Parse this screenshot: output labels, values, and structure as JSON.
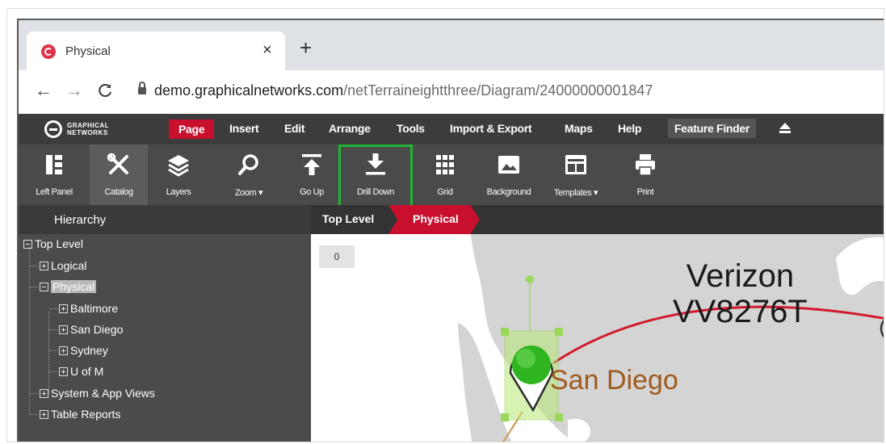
{
  "browser": {
    "tab_title": "Physical",
    "tab_close": "×",
    "new_tab": "+",
    "back": "←",
    "forward": "→",
    "reload": "C",
    "url_host": "demo.graphicalnetworks.com",
    "url_path": "/netTerraineightthree/Diagram/24000000001847"
  },
  "app": {
    "logo_line1": "GRAPHICAL",
    "logo_line2": "NETWORKS",
    "menu": [
      "Page",
      "Insert",
      "Edit",
      "Arrange",
      "Tools",
      "Import & Export",
      "Maps",
      "Help"
    ],
    "feature_finder": "Feature Finder",
    "colors": {
      "accent": "#c8102e",
      "highlight": "#21b534",
      "header": "#3c3c3c"
    }
  },
  "toolbar": {
    "tools": [
      {
        "label": "Left Panel",
        "icon": "left-panel-icon"
      },
      {
        "label": "Catalog",
        "icon": "catalog-tools-icon"
      },
      {
        "label": "Layers",
        "icon": "layers-icon"
      },
      {
        "label": "Zoom ▾",
        "icon": "zoom-icon"
      },
      {
        "label": "Go Up",
        "icon": "go-up-icon"
      },
      {
        "label": "Drill Down",
        "icon": "drill-down-icon"
      },
      {
        "label": "Grid",
        "icon": "grid-icon"
      },
      {
        "label": "Background",
        "icon": "background-image-icon"
      },
      {
        "label": "Templates ▾",
        "icon": "templates-icon"
      },
      {
        "label": "Print",
        "icon": "print-icon"
      }
    ]
  },
  "hierarchy": {
    "title": "Hierarchy",
    "nodes": [
      {
        "label": "Top Level",
        "expanded": true,
        "level": 0
      },
      {
        "label": "Logical",
        "expanded": false,
        "level": 1
      },
      {
        "label": "Physical",
        "expanded": true,
        "level": 1,
        "selected": true
      },
      {
        "label": "Baltimore",
        "expanded": false,
        "level": 2
      },
      {
        "label": "San Diego",
        "expanded": false,
        "level": 2
      },
      {
        "label": "Sydney",
        "expanded": false,
        "level": 2
      },
      {
        "label": "U of M",
        "expanded": false,
        "level": 2
      },
      {
        "label": "System & App Views",
        "expanded": false,
        "level": 1
      },
      {
        "label": "Table Reports",
        "expanded": false,
        "level": 1
      }
    ]
  },
  "canvas": {
    "breadcrumb": [
      "Top Level",
      "Physical"
    ],
    "zoom_badge": "0",
    "link_label_line1": "Verizon",
    "link_label_line2": "VV8276T",
    "node_label": "San Diego"
  }
}
